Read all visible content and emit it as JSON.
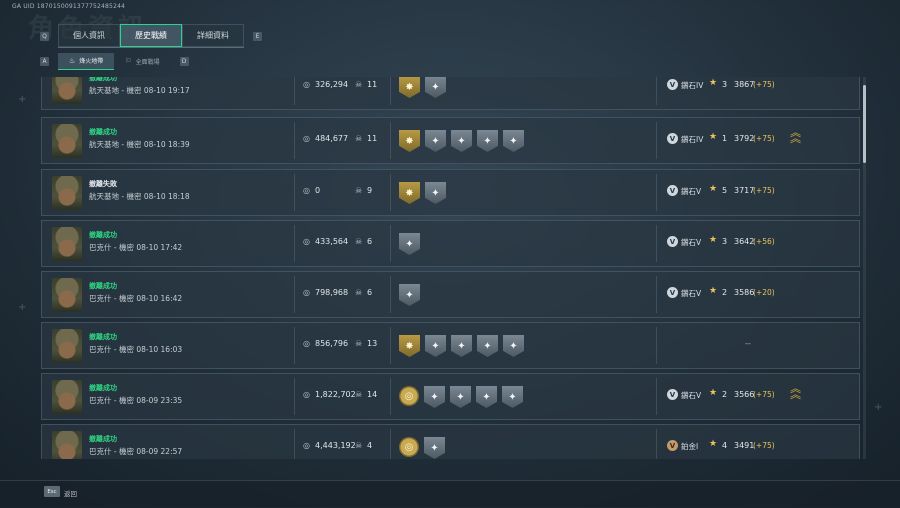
{
  "uid": "GA UID 1870150091377752485244",
  "bg_title": "角色資訊",
  "top_tabs": {
    "left_key": "Q",
    "right_key": "E",
    "items": [
      {
        "label": "個人資訊",
        "active": false
      },
      {
        "label": "歷史戰績",
        "active": true
      },
      {
        "label": "詳細資料",
        "active": false
      }
    ]
  },
  "sub_tabs": {
    "left_key": "A",
    "right_key": "D",
    "items": [
      {
        "label": "烽火地帶",
        "icon": "flame-icon",
        "active": true
      },
      {
        "label": "全面戰場",
        "icon": "battlefield-icon",
        "active": false
      }
    ]
  },
  "records": [
    {
      "outcome": "撤離成功",
      "status": "success",
      "map": "航天基地 - 機密 08-10 19:17",
      "value": "326,294",
      "kills": "11",
      "badges": [
        "gold",
        "gray"
      ],
      "rank": "鑽石IV",
      "level": "3",
      "score": "3867",
      "delta": "(+75)",
      "chevron": false
    },
    {
      "outcome": "撤離成功",
      "status": "success",
      "map": "航天基地 - 機密 08-10 18:39",
      "value": "484,677",
      "kills": "11",
      "badges": [
        "gold",
        "gray",
        "gray",
        "gray",
        "gray"
      ],
      "rank": "鑽石IV",
      "level": "1",
      "score": "3792",
      "delta": "(+75)",
      "chevron": true
    },
    {
      "outcome": "撤離失敗",
      "status": "fail",
      "map": "航天基地 - 機密 08-10 18:18",
      "value": "0",
      "kills": "9",
      "badges": [
        "gold",
        "gray"
      ],
      "rank": "鑽石V",
      "level": "5",
      "score": "3717",
      "delta": "(+75)",
      "chevron": false
    },
    {
      "outcome": "撤離成功",
      "status": "success",
      "map": "巴克什 - 機密 08-10 17:42",
      "value": "433,564",
      "kills": "6",
      "badges": [
        "gray"
      ],
      "rank": "鑽石V",
      "level": "3",
      "score": "3642",
      "delta": "(+56)",
      "chevron": false
    },
    {
      "outcome": "撤離成功",
      "status": "success",
      "map": "巴克什 - 機密 08-10 16:42",
      "value": "798,968",
      "kills": "6",
      "badges": [
        "gray"
      ],
      "rank": "鑽石V",
      "level": "2",
      "score": "3586",
      "delta": "(+20)",
      "chevron": false
    },
    {
      "outcome": "撤離成功",
      "status": "success",
      "map": "巴克什 - 機密 08-10 16:03",
      "value": "856,796",
      "kills": "13",
      "badges": [
        "gold",
        "gray",
        "gray",
        "gray",
        "gray"
      ],
      "rank": "",
      "level": "",
      "score": "",
      "delta": "",
      "dash": "--",
      "chevron": false
    },
    {
      "outcome": "撤離成功",
      "status": "success",
      "map": "巴克什 - 機密 08-09 23:35",
      "value": "1,822,702",
      "kills": "14",
      "badges": [
        "goldround",
        "gray",
        "gray",
        "gray",
        "gray"
      ],
      "rank": "鑽石V",
      "level": "2",
      "score": "3566",
      "delta": "(+75)",
      "chevron": true
    },
    {
      "outcome": "撤離成功",
      "status": "success",
      "map": "巴克什 - 機密 08-09 22:57",
      "value": "4,443,192",
      "kills": "4",
      "badges": [
        "goldround",
        "gray"
      ],
      "rank": "鉑金I",
      "level": "4",
      "score": "3491",
      "delta": "(+75)",
      "chevron": false,
      "rank_tier": "bronze"
    }
  ],
  "bottom": {
    "esc_key": "Esc",
    "back_label": "返回"
  },
  "colors": {
    "accent": "#2ad38f",
    "success": "#2fd584",
    "gold": "#e7c35a"
  }
}
